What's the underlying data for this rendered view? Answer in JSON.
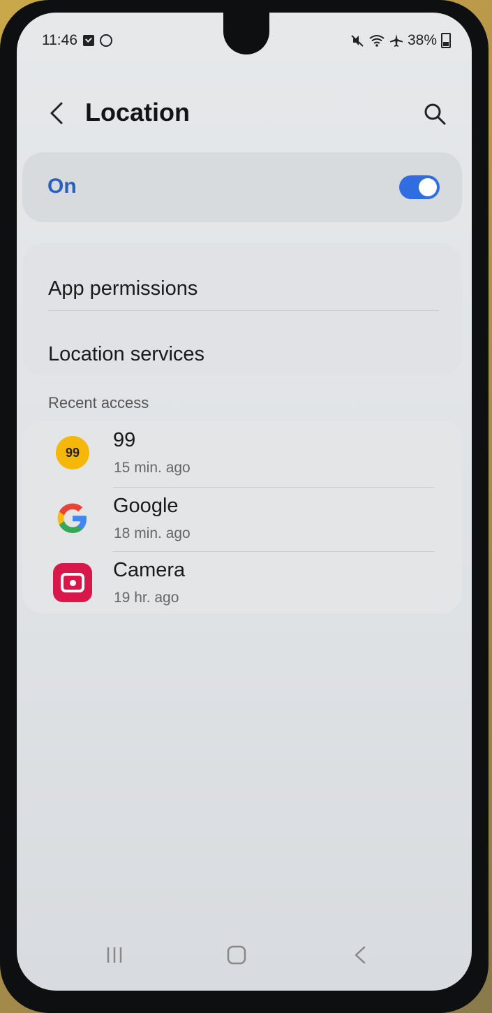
{
  "status": {
    "time": "11:46",
    "battery": "38%"
  },
  "header": {
    "title": "Location"
  },
  "toggle": {
    "label": "On",
    "enabled": true,
    "color": "#2f6de0"
  },
  "menu": [
    {
      "label": "App permissions"
    },
    {
      "label": "Location services"
    }
  ],
  "recent": {
    "label": "Recent access",
    "apps": [
      {
        "name": "99",
        "time": "15 min. ago",
        "icon": "99-app-icon",
        "icon_text": "99"
      },
      {
        "name": "Google",
        "time": "18 min. ago",
        "icon": "google-icon"
      },
      {
        "name": "Camera",
        "time": "19 hr. ago",
        "icon": "camera-icon"
      }
    ]
  },
  "nav": {
    "icons": [
      "recents-icon",
      "home-icon",
      "back-icon"
    ]
  }
}
